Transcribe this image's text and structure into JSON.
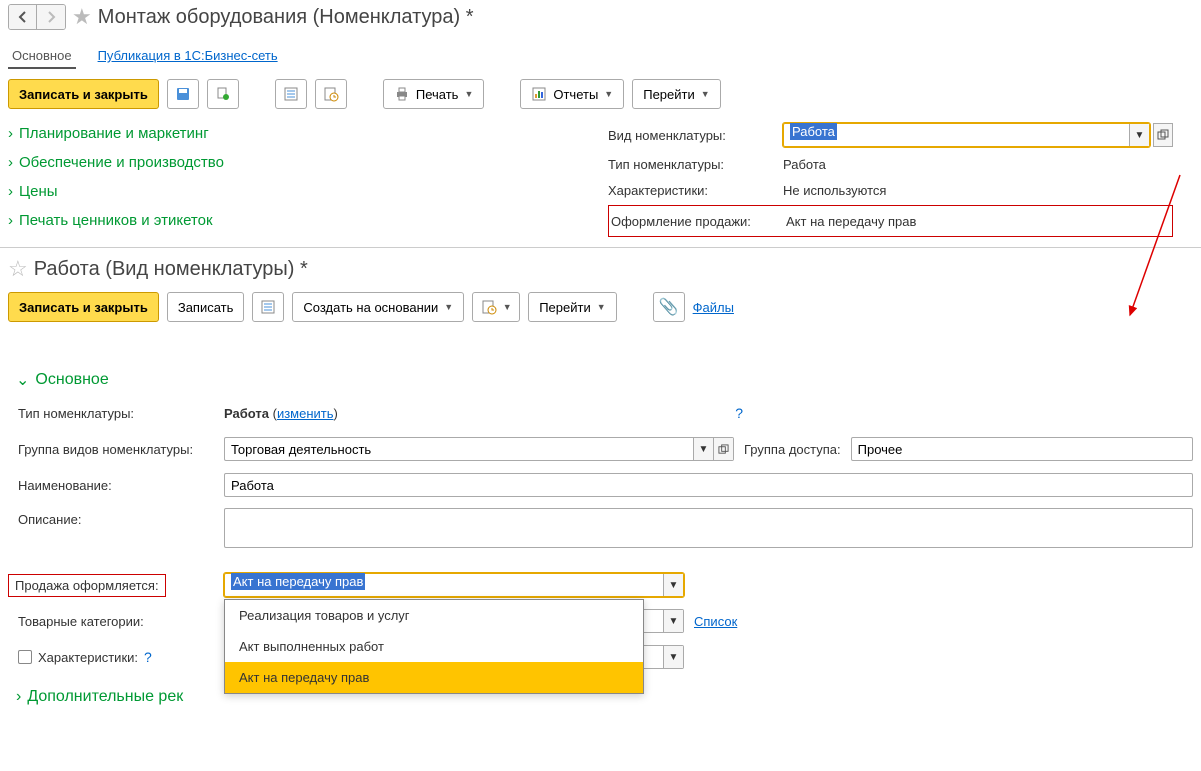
{
  "section1": {
    "title": "Монтаж оборудования (Номенклатура) *",
    "tabs": {
      "main": "Основное",
      "publish": "Публикация в 1С:Бизнес-сеть"
    },
    "toolbar": {
      "save_close": "Записать и закрыть",
      "print": "Печать",
      "reports": "Отчеты",
      "goto": "Перейти"
    },
    "expanders": {
      "planning": "Планирование и маркетинг",
      "supply": "Обеспечение и производство",
      "prices": "Цены",
      "print_tags": "Печать ценников и этикеток"
    },
    "info": {
      "kind_label": "Вид номенклатуры:",
      "kind_value": "Работа",
      "type_label": "Тип номенклатуры:",
      "type_value": "Работа",
      "chars_label": "Характеристики:",
      "chars_value": "Не используются",
      "sale_label": "Оформление продажи:",
      "sale_value": "Акт на передачу прав"
    }
  },
  "section2": {
    "title": "Работа (Вид номенклатуры) *",
    "toolbar": {
      "save_close": "Записать и закрыть",
      "save": "Записать",
      "create_based": "Создать на основании",
      "goto": "Перейти",
      "files": "Файлы"
    },
    "main_header": "Основное",
    "fields": {
      "type_label": "Тип номенклатуры:",
      "type_value_bold": "Работа",
      "type_change": "изменить",
      "group_label": "Группа видов номенклатуры:",
      "group_value": "Торговая деятельность",
      "access_label": "Группа доступа:",
      "access_value": "Прочее",
      "name_label": "Наименование:",
      "name_value": "Работа",
      "desc_label": "Описание:",
      "sale_label": "Продажа оформляется:",
      "sale_value": "Акт на передачу прав",
      "categories_label": "Товарные категории:",
      "list_link": "Список",
      "chars_label": "Характеристики:",
      "additional": "Дополнительные рек"
    },
    "dropdown": {
      "opt1": "Реализация товаров и услуг",
      "opt2": "Акт выполненных работ",
      "opt3": "Акт на передачу прав"
    }
  }
}
